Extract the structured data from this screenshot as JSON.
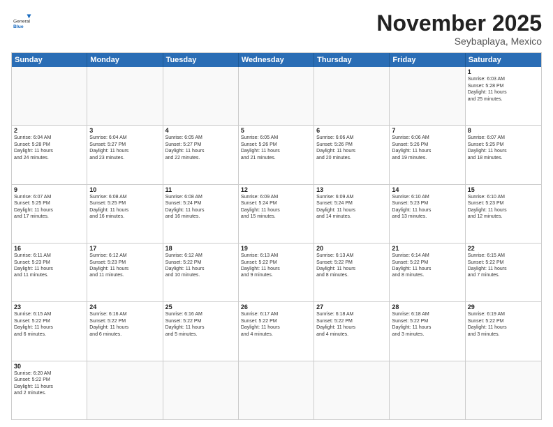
{
  "header": {
    "logo_general": "General",
    "logo_blue": "Blue",
    "month_title": "November 2025",
    "location": "Seybaplaya, Mexico"
  },
  "weekdays": [
    "Sunday",
    "Monday",
    "Tuesday",
    "Wednesday",
    "Thursday",
    "Friday",
    "Saturday"
  ],
  "rows": [
    [
      {
        "day": "",
        "text": ""
      },
      {
        "day": "",
        "text": ""
      },
      {
        "day": "",
        "text": ""
      },
      {
        "day": "",
        "text": ""
      },
      {
        "day": "",
        "text": ""
      },
      {
        "day": "",
        "text": ""
      },
      {
        "day": "1",
        "text": "Sunrise: 6:03 AM\nSunset: 5:28 PM\nDaylight: 11 hours\nand 25 minutes."
      }
    ],
    [
      {
        "day": "2",
        "text": "Sunrise: 6:04 AM\nSunset: 5:28 PM\nDaylight: 11 hours\nand 24 minutes."
      },
      {
        "day": "3",
        "text": "Sunrise: 6:04 AM\nSunset: 5:27 PM\nDaylight: 11 hours\nand 23 minutes."
      },
      {
        "day": "4",
        "text": "Sunrise: 6:05 AM\nSunset: 5:27 PM\nDaylight: 11 hours\nand 22 minutes."
      },
      {
        "day": "5",
        "text": "Sunrise: 6:05 AM\nSunset: 5:26 PM\nDaylight: 11 hours\nand 21 minutes."
      },
      {
        "day": "6",
        "text": "Sunrise: 6:06 AM\nSunset: 5:26 PM\nDaylight: 11 hours\nand 20 minutes."
      },
      {
        "day": "7",
        "text": "Sunrise: 6:06 AM\nSunset: 5:26 PM\nDaylight: 11 hours\nand 19 minutes."
      },
      {
        "day": "8",
        "text": "Sunrise: 6:07 AM\nSunset: 5:25 PM\nDaylight: 11 hours\nand 18 minutes."
      }
    ],
    [
      {
        "day": "9",
        "text": "Sunrise: 6:07 AM\nSunset: 5:25 PM\nDaylight: 11 hours\nand 17 minutes."
      },
      {
        "day": "10",
        "text": "Sunrise: 6:08 AM\nSunset: 5:25 PM\nDaylight: 11 hours\nand 16 minutes."
      },
      {
        "day": "11",
        "text": "Sunrise: 6:08 AM\nSunset: 5:24 PM\nDaylight: 11 hours\nand 16 minutes."
      },
      {
        "day": "12",
        "text": "Sunrise: 6:09 AM\nSunset: 5:24 PM\nDaylight: 11 hours\nand 15 minutes."
      },
      {
        "day": "13",
        "text": "Sunrise: 6:09 AM\nSunset: 5:24 PM\nDaylight: 11 hours\nand 14 minutes."
      },
      {
        "day": "14",
        "text": "Sunrise: 6:10 AM\nSunset: 5:23 PM\nDaylight: 11 hours\nand 13 minutes."
      },
      {
        "day": "15",
        "text": "Sunrise: 6:10 AM\nSunset: 5:23 PM\nDaylight: 11 hours\nand 12 minutes."
      }
    ],
    [
      {
        "day": "16",
        "text": "Sunrise: 6:11 AM\nSunset: 5:23 PM\nDaylight: 11 hours\nand 11 minutes."
      },
      {
        "day": "17",
        "text": "Sunrise: 6:12 AM\nSunset: 5:23 PM\nDaylight: 11 hours\nand 11 minutes."
      },
      {
        "day": "18",
        "text": "Sunrise: 6:12 AM\nSunset: 5:22 PM\nDaylight: 11 hours\nand 10 minutes."
      },
      {
        "day": "19",
        "text": "Sunrise: 6:13 AM\nSunset: 5:22 PM\nDaylight: 11 hours\nand 9 minutes."
      },
      {
        "day": "20",
        "text": "Sunrise: 6:13 AM\nSunset: 5:22 PM\nDaylight: 11 hours\nand 8 minutes."
      },
      {
        "day": "21",
        "text": "Sunrise: 6:14 AM\nSunset: 5:22 PM\nDaylight: 11 hours\nand 8 minutes."
      },
      {
        "day": "22",
        "text": "Sunrise: 6:15 AM\nSunset: 5:22 PM\nDaylight: 11 hours\nand 7 minutes."
      }
    ],
    [
      {
        "day": "23",
        "text": "Sunrise: 6:15 AM\nSunset: 5:22 PM\nDaylight: 11 hours\nand 6 minutes."
      },
      {
        "day": "24",
        "text": "Sunrise: 6:16 AM\nSunset: 5:22 PM\nDaylight: 11 hours\nand 6 minutes."
      },
      {
        "day": "25",
        "text": "Sunrise: 6:16 AM\nSunset: 5:22 PM\nDaylight: 11 hours\nand 5 minutes."
      },
      {
        "day": "26",
        "text": "Sunrise: 6:17 AM\nSunset: 5:22 PM\nDaylight: 11 hours\nand 4 minutes."
      },
      {
        "day": "27",
        "text": "Sunrise: 6:18 AM\nSunset: 5:22 PM\nDaylight: 11 hours\nand 4 minutes."
      },
      {
        "day": "28",
        "text": "Sunrise: 6:18 AM\nSunset: 5:22 PM\nDaylight: 11 hours\nand 3 minutes."
      },
      {
        "day": "29",
        "text": "Sunrise: 6:19 AM\nSunset: 5:22 PM\nDaylight: 11 hours\nand 3 minutes."
      }
    ],
    [
      {
        "day": "30",
        "text": "Sunrise: 6:20 AM\nSunset: 5:22 PM\nDaylight: 11 hours\nand 2 minutes."
      },
      {
        "day": "",
        "text": ""
      },
      {
        "day": "",
        "text": ""
      },
      {
        "day": "",
        "text": ""
      },
      {
        "day": "",
        "text": ""
      },
      {
        "day": "",
        "text": ""
      },
      {
        "day": "",
        "text": ""
      }
    ]
  ]
}
